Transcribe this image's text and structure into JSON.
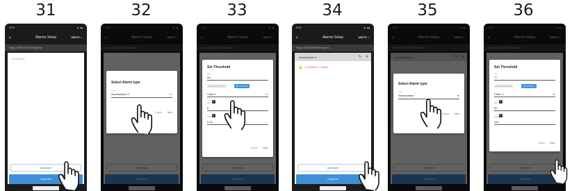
{
  "steps": [
    "31",
    "32",
    "33",
    "34",
    "35",
    "36"
  ],
  "screen": {
    "nav_title": "Alarms Setup",
    "units_label": "UNITS",
    "subtitle": "Setup SUBTOOLPOR Alarms",
    "empty_text": "No Alarms",
    "add_alarm_label": "Add Alarm",
    "continue_label": "Continue"
  },
  "alarm_type_dialog": {
    "title": "Select Alarm type",
    "field_label": "Type",
    "value_32": "Acceleration X",
    "value_35": "Temperature",
    "cancel_label": "Cancel",
    "next_label": "Next"
  },
  "threshold_dialog": {
    "title": "Set Threshold",
    "field_label": "Unit",
    "value_33": "Inh",
    "value_36": "°F",
    "seg_left": "Absolute Alm Value",
    "seg_right": "ISO Vib Alarm",
    "class_value": "Class 1",
    "alarm_label": "Alm",
    "warn_label": "Warn",
    "alarm_value_33": "8",
    "warn_value_33": "0.03",
    "alarm_value_36": "40",
    "warn_value_36": "220",
    "cancel_label": "Cancel",
    "save_label": "Save"
  },
  "alarm_item": {
    "name": "Acceleration X",
    "condition": "> 0.01inch, > 0inch"
  },
  "colors": {
    "accent": "#3f8fd8",
    "alarm_red": "#d23b2e",
    "phone_dark": "#1b1b1b"
  }
}
